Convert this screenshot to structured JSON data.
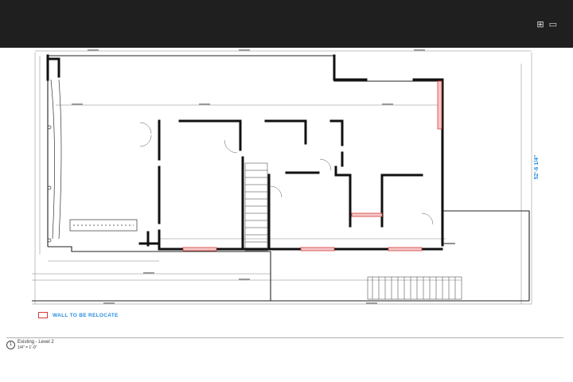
{
  "toolbar": {
    "icons": [
      "grid-icon",
      "options-icon"
    ]
  },
  "legend": {
    "label": "WALL TO BE RELOCATE",
    "swatch_color": "#d43b3b"
  },
  "dimensions": {
    "overall_depth": "52'-6 1/4\"",
    "overall_depth_color": "#2a8de0"
  },
  "title_block": {
    "number": "1",
    "name": "Existing - Level 2",
    "scale": "1/4\" = 1'-0\""
  }
}
